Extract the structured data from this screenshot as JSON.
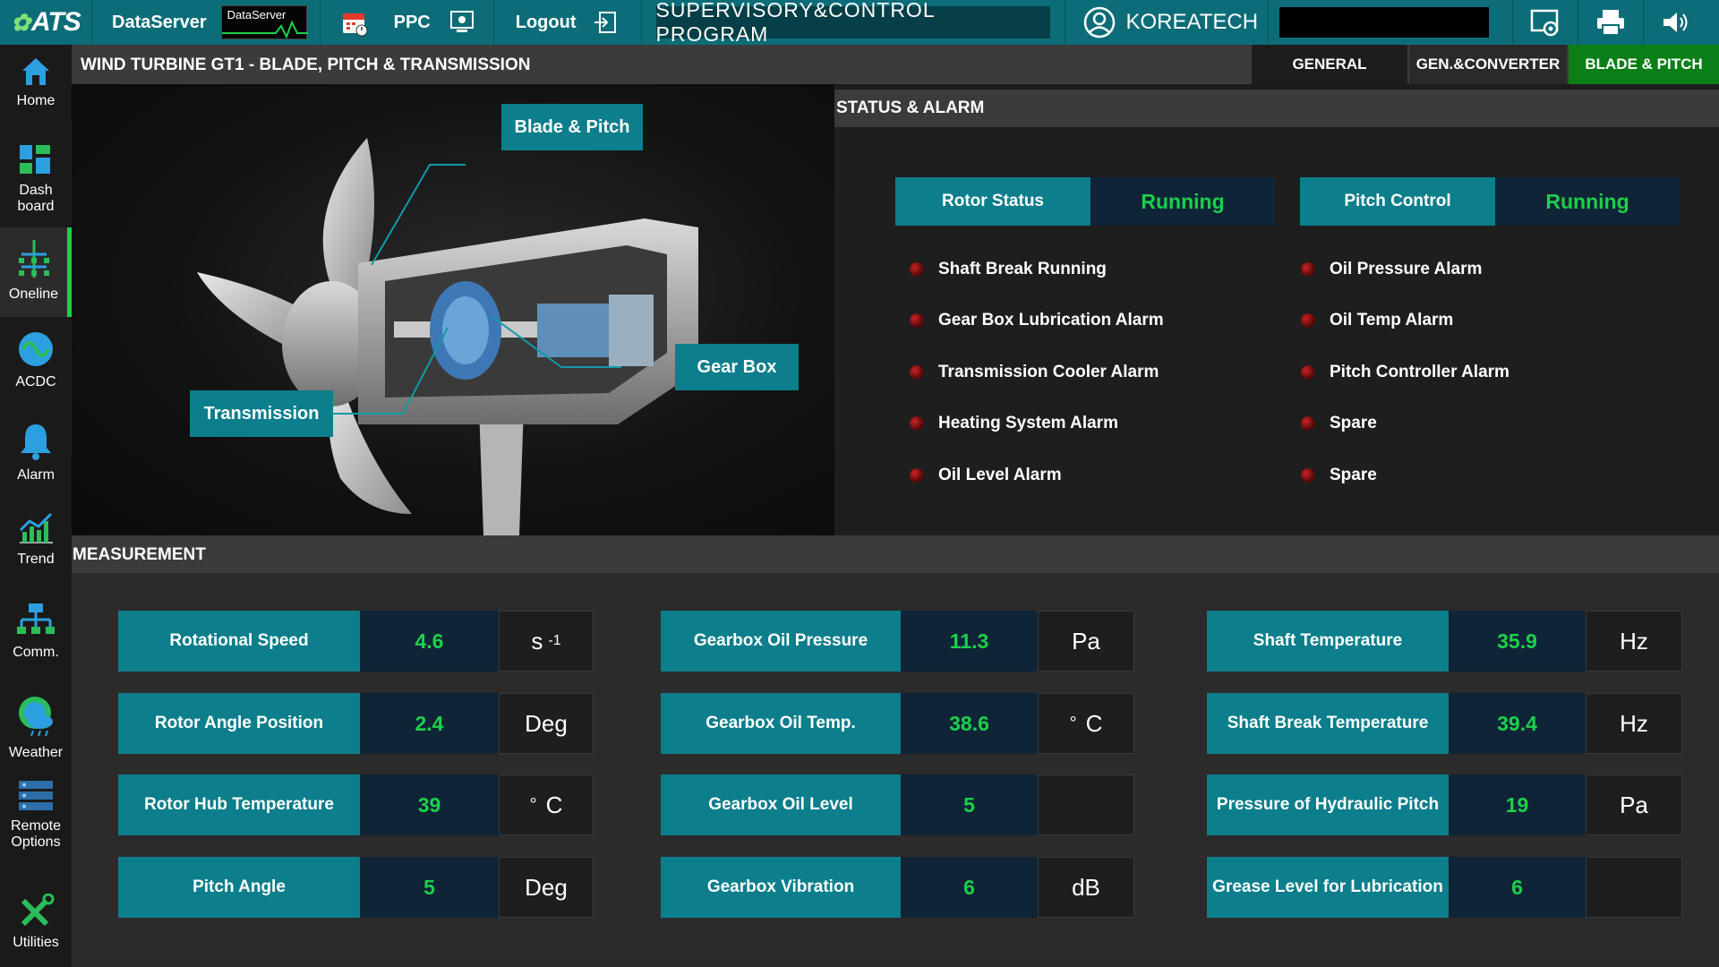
{
  "topbar": {
    "logo": "ATS",
    "dataserver_label": "DataServer",
    "dataserver_box_label": "DataServer",
    "ppc_label": "PPC",
    "logout_label": "Logout",
    "program_title": "SUPERVISORY&CONTROL PROGRAM",
    "user": "KOREATECH",
    "icons": [
      "calendar-icon",
      "ppc-monitor-icon",
      "logout-icon",
      "user-icon",
      "screenshot-icon",
      "print-icon",
      "speaker-icon"
    ]
  },
  "sidebar": {
    "items": [
      {
        "label": "Home",
        "icon": "home-icon"
      },
      {
        "label": "Dash board",
        "icon": "dashboard-icon"
      },
      {
        "label": "Oneline",
        "icon": "oneline-icon"
      },
      {
        "label": "ACDC",
        "icon": "acdc-icon"
      },
      {
        "label": "Alarm",
        "icon": "bell-icon"
      },
      {
        "label": "Trend",
        "icon": "trend-icon"
      },
      {
        "label": "Comm.",
        "icon": "network-icon"
      },
      {
        "label": "Weather",
        "icon": "weather-icon"
      },
      {
        "label": "Remote Options",
        "icon": "remote-icon"
      },
      {
        "label": "Utilities",
        "icon": "tools-icon"
      }
    ],
    "active": "Oneline"
  },
  "header": {
    "title": "WIND TURBINE  GT1 - BLADE, PITCH & TRANSMISSION",
    "tabs": [
      {
        "label": "GENERAL"
      },
      {
        "label": "GEN.&CONVERTER"
      },
      {
        "label": "BLADE & PITCH"
      }
    ],
    "active_tab": "BLADE & PITCH"
  },
  "turbine": {
    "callouts": {
      "blade_pitch": "Blade & Pitch",
      "transmission": "Transmission",
      "gear_box": "Gear Box"
    }
  },
  "status": {
    "title": "STATUS & ALARM",
    "rotor_status": {
      "label": "Rotor Status",
      "value": "Running"
    },
    "pitch_control": {
      "label": "Pitch Control",
      "value": "Running"
    },
    "alarms_left": [
      "Shaft Break Running",
      "Gear Box Lubrication Alarm",
      "Transmission Cooler Alarm",
      "Heating System Alarm",
      "Oil Level Alarm"
    ],
    "alarms_right": [
      "Oil Pressure Alarm",
      "Oil Temp Alarm",
      "Pitch Controller Alarm",
      "Spare",
      "Spare"
    ],
    "colors": {
      "running": "#1bd14a",
      "alarm_off": "#5a0b0b"
    }
  },
  "measurement": {
    "title": "MEASUREMENT",
    "col1": [
      {
        "label": "Rotational Speed",
        "value": "4.6",
        "unit": "s",
        "unit_sup": "-1"
      },
      {
        "label": "Rotor Angle Position",
        "value": "2.4",
        "unit": "Deg",
        "unit_sup": ""
      },
      {
        "label": "Rotor Hub Temperature",
        "value": "39",
        "unit": "C",
        "unit_sup": "°"
      },
      {
        "label": "Pitch Angle",
        "value": "5",
        "unit": "Deg",
        "unit_sup": ""
      }
    ],
    "col2": [
      {
        "label": "Gearbox Oil Pressure",
        "value": "11.3",
        "unit": "Pa",
        "unit_sup": ""
      },
      {
        "label": "Gearbox Oil Temp.",
        "value": "38.6",
        "unit": "C",
        "unit_sup": "°"
      },
      {
        "label": "Gearbox Oil Level",
        "value": "5",
        "unit": "",
        "unit_sup": ""
      },
      {
        "label": "Gearbox Vibration",
        "value": "6",
        "unit": "dB",
        "unit_sup": ""
      }
    ],
    "col3": [
      {
        "label": "Shaft Temperature",
        "value": "35.9",
        "unit": "Hz",
        "unit_sup": ""
      },
      {
        "label": "Shaft Break Temperature",
        "value": "39.4",
        "unit": "Hz",
        "unit_sup": ""
      },
      {
        "label": "Pressure of Hydraulic Pitch",
        "value": "19",
        "unit": "Pa",
        "unit_sup": ""
      },
      {
        "label": "Grease Level for Lubrication",
        "value": "6",
        "unit": "",
        "unit_sup": ""
      }
    ]
  }
}
